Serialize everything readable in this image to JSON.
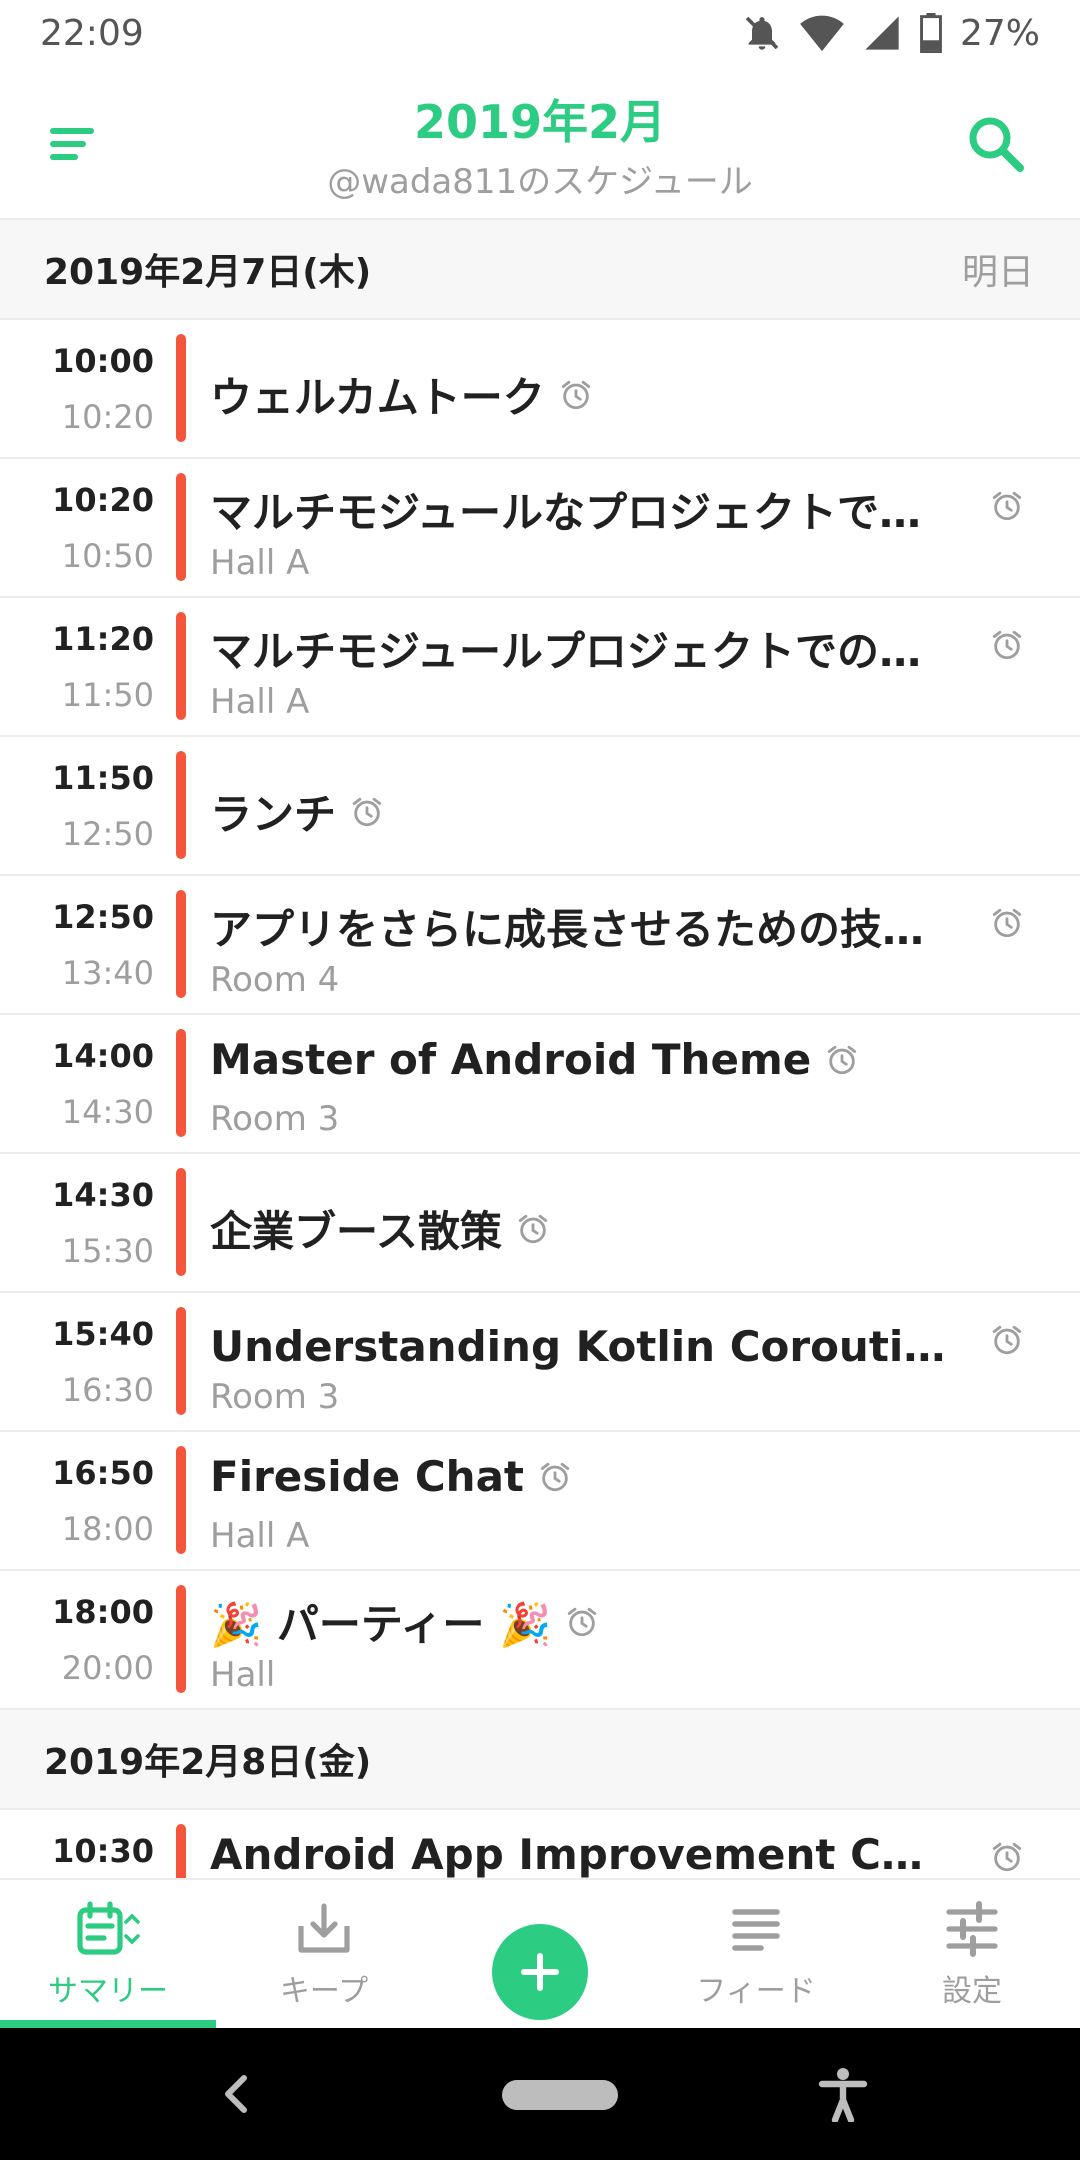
{
  "status_bar": {
    "time": "22:09",
    "battery": "27%"
  },
  "app_bar": {
    "title": "2019年2月",
    "subtitle": "@wada811のスケジュール"
  },
  "days": [
    {
      "date": "2019年2月7日(木)",
      "relative": "明日",
      "sessions": [
        {
          "start": "10:00",
          "end": "10:20",
          "title": "ウェルカムトーク",
          "room": ""
        },
        {
          "start": "10:20",
          "end": "10:50",
          "title": "マルチモジュールなプロジェクトで…",
          "room": "Hall A"
        },
        {
          "start": "11:20",
          "end": "11:50",
          "title": "マルチモジュールプロジェクトでのD…",
          "room": "Hall A"
        },
        {
          "start": "11:50",
          "end": "12:50",
          "title": "ランチ",
          "room": ""
        },
        {
          "start": "12:50",
          "end": "13:40",
          "title": "アプリをさらに成長させるための技…",
          "room": "Room 4"
        },
        {
          "start": "14:00",
          "end": "14:30",
          "title": "Master of Android Theme",
          "room": "Room 3"
        },
        {
          "start": "14:30",
          "end": "15:30",
          "title": "企業ブース散策",
          "room": ""
        },
        {
          "start": "15:40",
          "end": "16:30",
          "title": "Understanding Kotlin Coroutines: コ…",
          "room": "Room 3"
        },
        {
          "start": "16:50",
          "end": "18:00",
          "title": "Fireside Chat",
          "room": "Hall A"
        },
        {
          "start": "18:00",
          "end": "20:00",
          "title": "🎉 パーティー 🎉",
          "room": "Hall"
        }
      ]
    },
    {
      "date": "2019年2月8日(金)",
      "relative": "",
      "sessions": [
        {
          "start": "10:30",
          "end": "",
          "title": "Android App Improvement Challenge…",
          "room": ""
        }
      ]
    }
  ],
  "bottom_nav": {
    "summary": "サマリー",
    "keep": "キープ",
    "feed": "フィード",
    "settings": "設定"
  },
  "colors": {
    "accent": "#2dcc83",
    "session_bar": "#f4563b"
  }
}
